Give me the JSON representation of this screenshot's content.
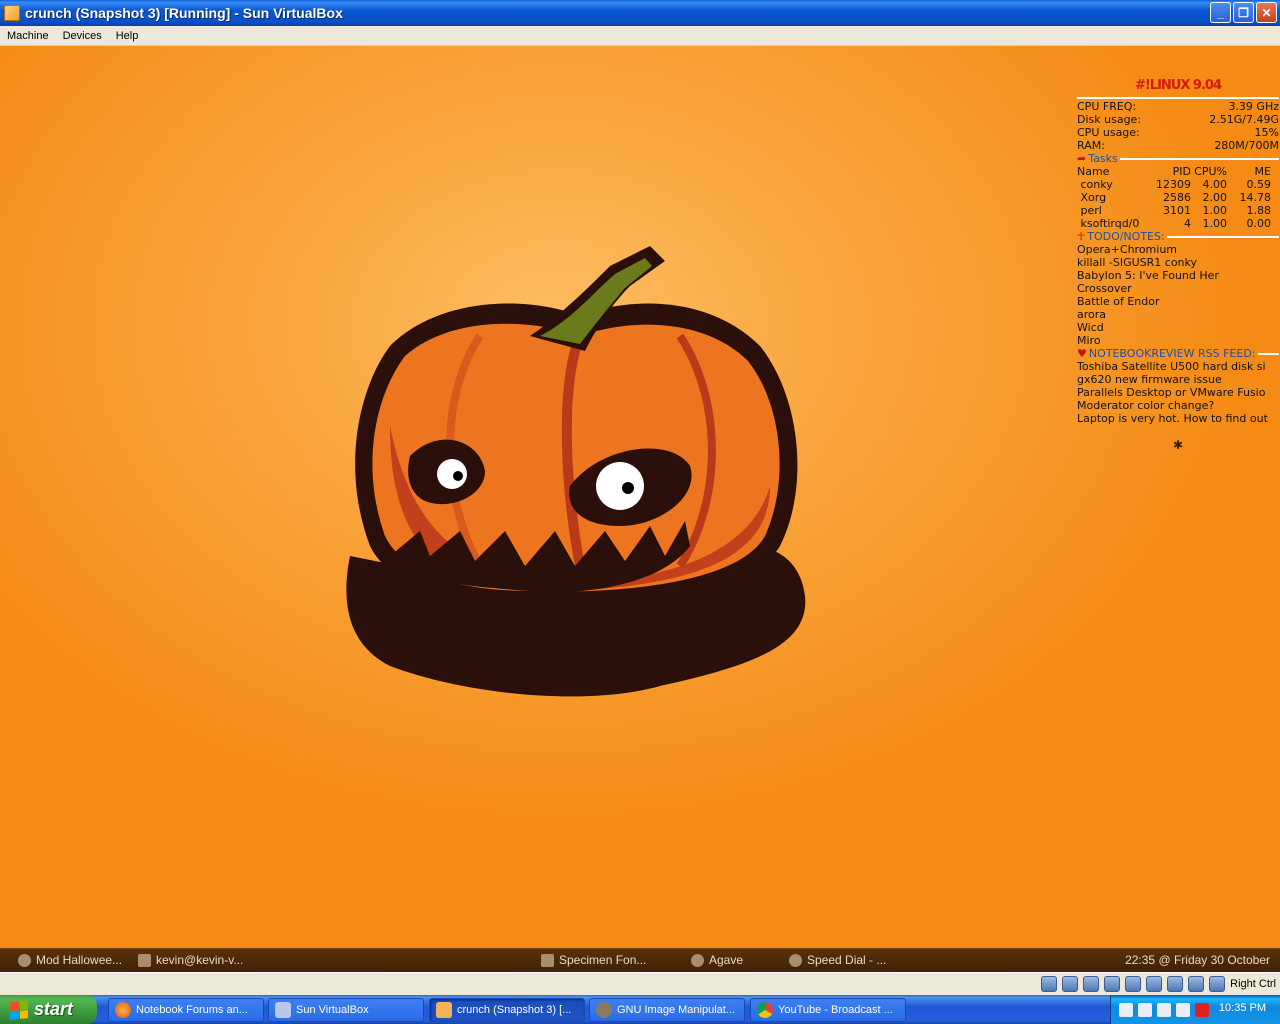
{
  "window": {
    "title": "crunch (Snapshot 3) [Running] - Sun VirtualBox",
    "menu": [
      "Machine",
      "Devices",
      "Help"
    ]
  },
  "conky": {
    "logo": "#!LINUX 9.04",
    "stats": [
      {
        "label": "CPU FREQ:",
        "value": "3.39 GHz"
      },
      {
        "label": "Disk usage:",
        "value": "2.51G/7.49G"
      },
      {
        "label": "CPU usage:",
        "value": "15%"
      },
      {
        "label": "RAM:",
        "value": "280M/700M"
      }
    ],
    "tasks_title": "Tasks",
    "tasks_header": [
      "Name",
      "PID",
      "CPU%",
      "ME"
    ],
    "tasks": [
      [
        "conky",
        "12309",
        "4.00",
        "0.59"
      ],
      [
        "Xorg",
        "2586",
        "2.00",
        "14.78"
      ],
      [
        "perl",
        "3101",
        "1.00",
        "1.88"
      ],
      [
        "ksoftirqd/0",
        "4",
        "1.00",
        "0.00"
      ]
    ],
    "todo_title": "TODO/NOTES:",
    "todo": [
      "Opera+Chromium",
      "killall -SIGUSR1 conky",
      "Babylon 5: I've Found Her",
      "Crossover",
      "Battle of Endor",
      "arora",
      "Wicd",
      "Miro"
    ],
    "rss_title": "NOTEBOOKREVIEW RSS FEED:",
    "rss": [
      "Toshiba Satellite U500 hard disk si",
      "gx620 new firmware issue",
      "Parallels Desktop or VMware Fusio",
      "Moderator color change?",
      "Laptop is very hot. How to find out"
    ]
  },
  "guest_panel": {
    "items": [
      "Mod Hallowee...",
      "kevin@kevin-v...",
      "Specimen Fon...",
      "Agave",
      "Speed Dial - ..."
    ],
    "clock": "22:35 @ Friday 30 October"
  },
  "vb_status": {
    "host_key": "Right Ctrl"
  },
  "taskbar": {
    "start": "start",
    "buttons": [
      "Notebook Forums an...",
      "Sun VirtualBox",
      "crunch (Snapshot 3) [...",
      "GNU Image Manipulat...",
      "YouTube - Broadcast ..."
    ],
    "clock": "10:35 PM"
  },
  "colors": {
    "desktop_orange": "#f7981e",
    "conky_accent": "#d31a0e",
    "conky_section": "#1e4f9f",
    "xp_blue": "#245edb",
    "start_green": "#3d9a3d"
  }
}
